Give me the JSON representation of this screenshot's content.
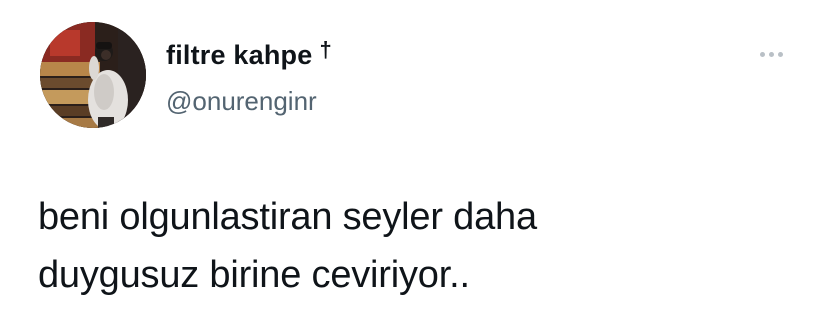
{
  "tweet": {
    "author": {
      "display_name": "filtre kahpe",
      "name_symbol": "†",
      "handle": "@onurenginr",
      "avatar_icon": "profile-photo"
    },
    "menu_icon": "more-options-icon",
    "text_lines": [
      "beni olgunlastiran seyler daha",
      "duygusuz birine ceviriyor.."
    ]
  },
  "colors": {
    "text": "#0f1419",
    "secondary_text": "#536471",
    "menu_dots": "#b9c0c6",
    "background": "#ffffff"
  }
}
